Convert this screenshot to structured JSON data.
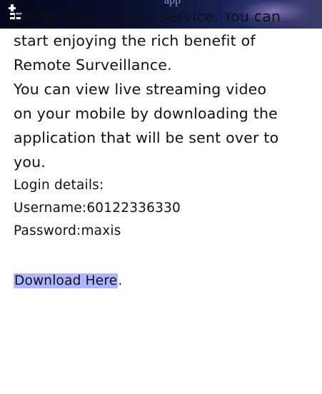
{
  "status_bar": {
    "top_text": "app",
    "signal_icon": "signal-antenna-icon",
    "gradient_colors": [
      "#05081a",
      "#1a2656",
      "#3a3f6a"
    ]
  },
  "message": {
    "cut_line": "being a part of this service. You can",
    "lines": [
      "start enjoying the rich benefit of",
      "Remote Surveillance.",
      "You can view live streaming video",
      "on your mobile by downloading the",
      "application that will be sent over to",
      "you."
    ],
    "login_heading": "Login details:",
    "username": "Username:60122336330",
    "password": "Password:maxis",
    "download_label": "Download Here",
    "download_suffix": "."
  },
  "colors": {
    "link_highlight": "#aeb6ff",
    "text": "#111111"
  }
}
